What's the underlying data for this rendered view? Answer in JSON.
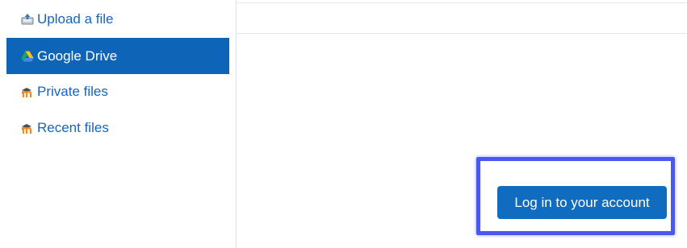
{
  "sidebar": {
    "items": [
      {
        "label": "Upload a file",
        "icon": "upload-icon",
        "active": false
      },
      {
        "label": "Google Drive",
        "icon": "google-drive-icon",
        "active": true
      },
      {
        "label": "Private files",
        "icon": "moodle-icon",
        "active": false
      },
      {
        "label": "Recent files",
        "icon": "moodle-icon",
        "active": false
      }
    ]
  },
  "main": {
    "login_button_label": "Log in to your account"
  },
  "colors": {
    "accent": "#0f6cbf",
    "active_item_bg": "#0e65b8",
    "link": "#1565c0",
    "highlight": "#4a57f0"
  }
}
